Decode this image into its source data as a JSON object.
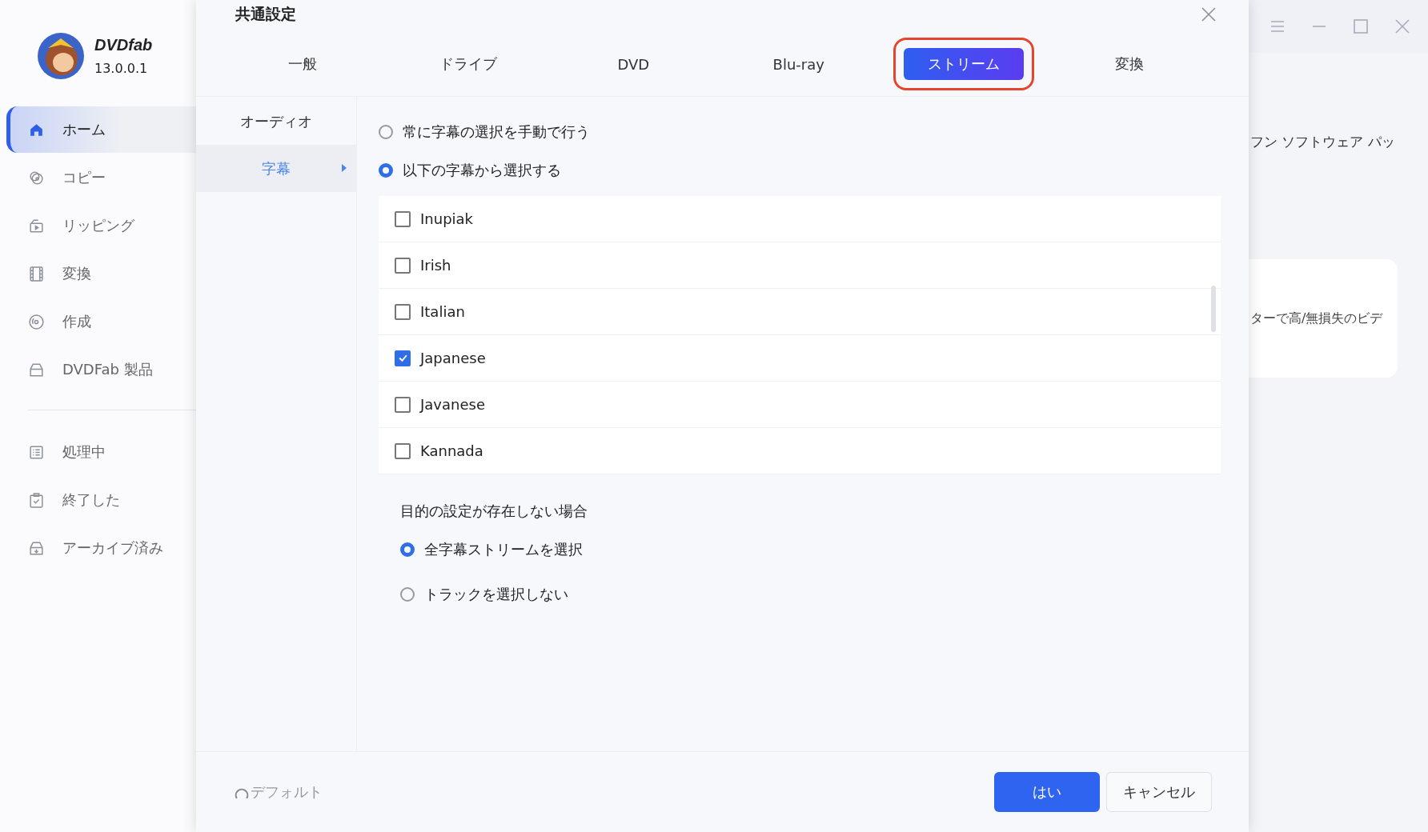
{
  "app": {
    "brand": "DVDfab",
    "version": "13.0.0.1"
  },
  "sidebar": {
    "items": [
      {
        "label": "ホーム",
        "kind": "home",
        "selected": true
      },
      {
        "label": "コピー",
        "kind": "copy",
        "selected": false
      },
      {
        "label": "リッピング",
        "kind": "rip",
        "selected": false
      },
      {
        "label": "変換",
        "kind": "film",
        "selected": false
      },
      {
        "label": "作成",
        "kind": "disc",
        "selected": false
      },
      {
        "label": "DVDFab 製品",
        "kind": "box",
        "selected": false
      }
    ],
    "queue_items": [
      {
        "label": "処理中",
        "kind": "list",
        "selected": false
      },
      {
        "label": "終了した",
        "kind": "clip",
        "selected": false
      },
      {
        "label": "アーカイブ済み",
        "kind": "archive",
        "selected": false
      }
    ]
  },
  "background": {
    "banner_text": "フン ソフトウェア パッ",
    "card_text": "ターで高/無損失のビデ"
  },
  "dialog": {
    "title": "共通設定",
    "tabs": [
      {
        "label": "一般",
        "selected": false
      },
      {
        "label": "ドライブ",
        "selected": false
      },
      {
        "label": "DVD",
        "selected": false
      },
      {
        "label": "Blu-ray",
        "selected": false
      },
      {
        "label": "ストリーム",
        "selected": true
      },
      {
        "label": "変換",
        "selected": false
      }
    ],
    "subnav": [
      {
        "label": "オーディオ",
        "selected": false
      },
      {
        "label": "字幕",
        "selected": true
      }
    ],
    "mode_options": [
      {
        "label": "常に字幕の選択を手動で行う",
        "selected": false
      },
      {
        "label": "以下の字幕から選択する",
        "selected": true
      }
    ],
    "languages": [
      {
        "label": "Inupiak",
        "checked": false
      },
      {
        "label": "Irish",
        "checked": false
      },
      {
        "label": "Italian",
        "checked": false
      },
      {
        "label": "Japanese",
        "checked": true
      },
      {
        "label": "Javanese",
        "checked": false
      },
      {
        "label": "Kannada",
        "checked": false
      }
    ],
    "fallback": {
      "heading": "目的の設定が存在しない場合",
      "options": [
        {
          "label": "全字幕ストリームを選択",
          "selected": true
        },
        {
          "label": "トラックを選択しない",
          "selected": false
        }
      ]
    },
    "default_link": "デフォルト",
    "buttons": [
      {
        "label": "はい",
        "kind": "primary"
      },
      {
        "label": "キャンセル",
        "kind": "secondary"
      }
    ]
  }
}
